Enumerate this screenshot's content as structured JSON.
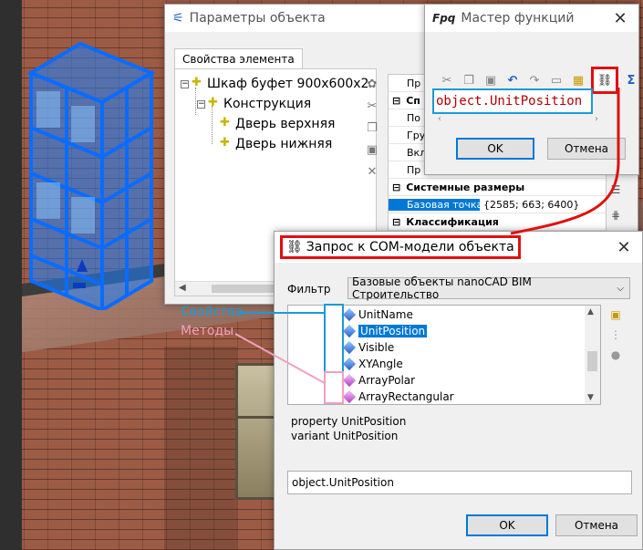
{
  "params_window": {
    "title": "Параметры объекта",
    "tab": "Свойства элемента",
    "tree": {
      "root": "Шкаф буфет 900х600х2",
      "child": "Конструкция",
      "leaf1": "Дверь верхняя",
      "leaf2": "Дверь нижняя"
    },
    "grid": {
      "row1": "Пр",
      "section1": "Сп",
      "row3": "По",
      "row4": "Гру",
      "row5": "Вкл",
      "row6": "Пр",
      "section2": "Системные размеры",
      "base_point_key": "Базовая точка",
      "base_point_val": "{2585; 663; 6400}",
      "section3": "Классификация"
    }
  },
  "function_wizard": {
    "logo": "Fpq",
    "title": "Мастер функций",
    "expression": "object.UnitPosition",
    "ok": "OK",
    "cancel": "Отмена"
  },
  "com_dialog": {
    "title": "Запрос к COM-модели объекта",
    "filter_label": "Фильтр",
    "filter_value": "Базовые объекты nanoCAD BIM Строительство",
    "items": {
      "i0": "UnitName",
      "i1": "UnitPosition",
      "i2": "Visible",
      "i3": "XYAngle",
      "i4": "ArrayPolar",
      "i5": "ArrayRectangular"
    },
    "info_line1": "property UnitPosition",
    "info_line2": "variant UnitPosition",
    "expression": "object.UnitPosition",
    "ok": "OK",
    "cancel": "Отмена"
  },
  "callouts": {
    "properties": "Свойства",
    "methods": "Методы"
  },
  "colors": {
    "selection_blue": "#0078d7",
    "highlight_red": "#e01010",
    "callout_cyan": "#1a9ad6",
    "callout_pink": "#f0a0c0"
  }
}
